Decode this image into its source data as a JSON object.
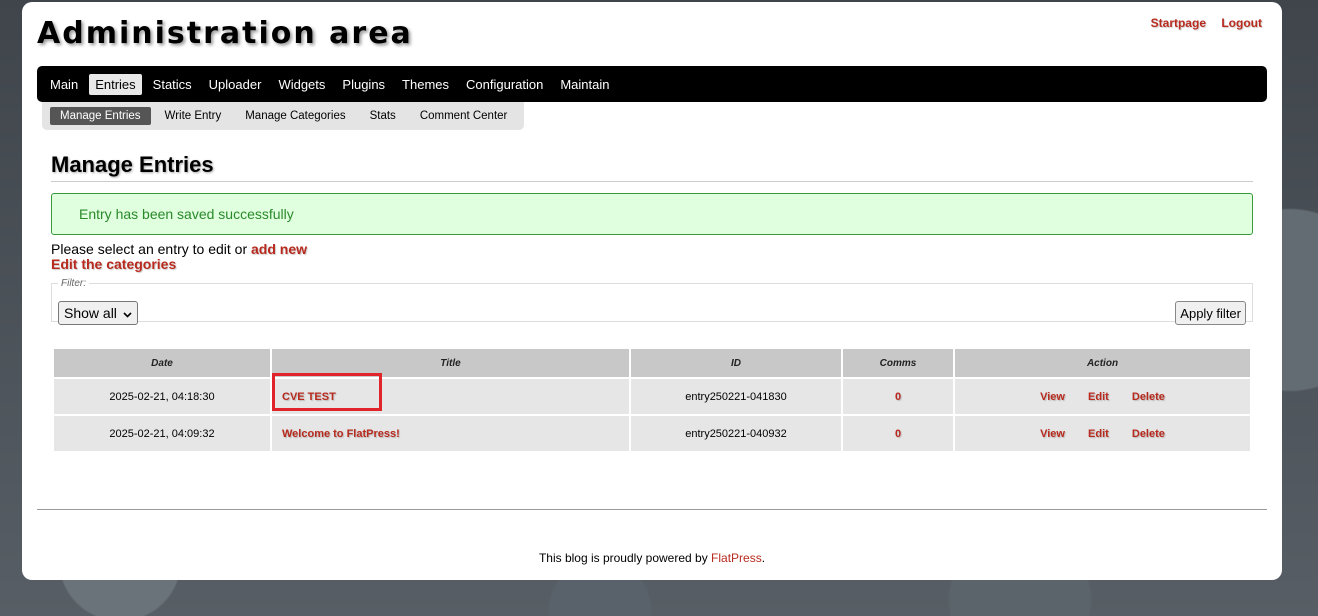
{
  "header": {
    "title": "Administration area",
    "links": [
      "Startpage",
      "Logout"
    ]
  },
  "mainnav": {
    "items": [
      "Main",
      "Entries",
      "Statics",
      "Uploader",
      "Widgets",
      "Plugins",
      "Themes",
      "Configuration",
      "Maintain"
    ],
    "active": "Entries"
  },
  "subnav": {
    "items": [
      "Manage Entries",
      "Write Entry",
      "Manage Categories",
      "Stats",
      "Comment Center"
    ],
    "active": "Manage Entries"
  },
  "main": {
    "heading": "Manage Entries",
    "success_message": "Entry has been saved successfully",
    "intro_text": "Please select an entry to edit or ",
    "add_new_label": "add new",
    "edit_categories_label": "Edit the categories",
    "filter": {
      "legend": "Filter:",
      "selected": "Show all",
      "apply_label": "Apply filter"
    },
    "table": {
      "columns": [
        "Date",
        "Title",
        "ID",
        "Comms",
        "Action"
      ],
      "rows": [
        {
          "date": "2025-02-21, 04:18:30",
          "title": "CVE TEST",
          "id": "entry250221-041830",
          "comms": "0",
          "actions": [
            "View",
            "Edit",
            "Delete"
          ]
        },
        {
          "date": "2025-02-21, 04:09:32",
          "title": "Welcome to FlatPress!",
          "id": "entry250221-040932",
          "comms": "0",
          "actions": [
            "View",
            "Edit",
            "Delete"
          ]
        }
      ]
    }
  },
  "footer": {
    "text": "This blog is proudly powered by ",
    "link": "FlatPress",
    "suffix": "."
  },
  "colors": {
    "accent": "#b82a1e",
    "success_bg": "#dfffdf",
    "success_text": "#2a8a2a",
    "highlight": "#e0242a"
  }
}
